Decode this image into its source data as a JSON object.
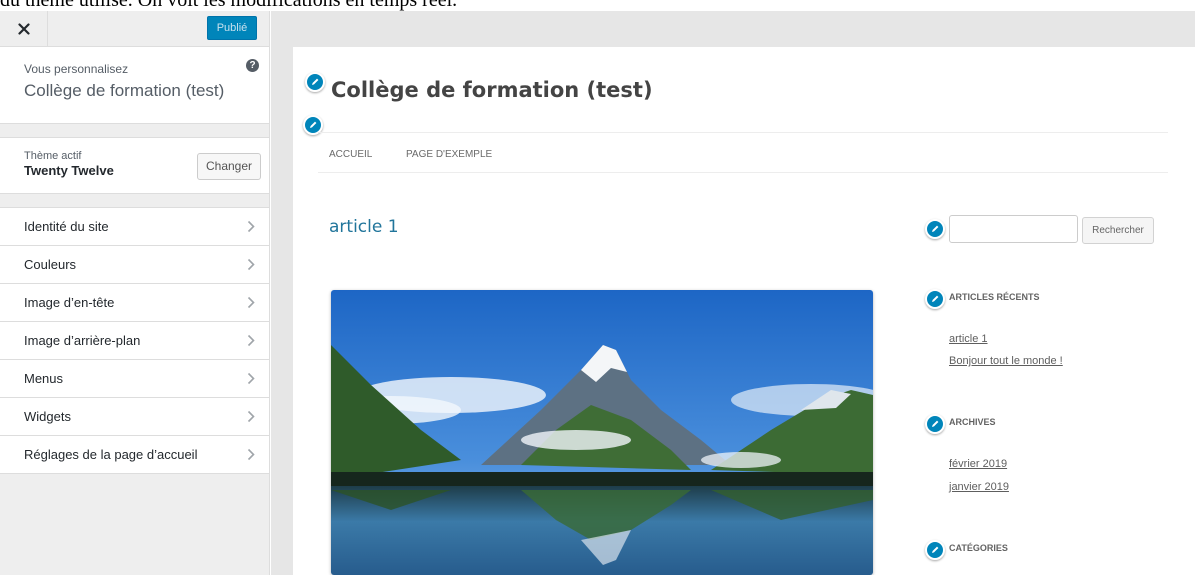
{
  "caption": "du thème utilisé. On voit les modifications en temps réel.",
  "sidebar": {
    "publish_label": "Publié",
    "customizing_label": "Vous personnalisez",
    "site_name": "Collège de formation (test)",
    "help_glyph": "?",
    "theme_label": "Thème actif",
    "theme_name": "Twenty Twelve",
    "change_label": "Changer",
    "items": [
      {
        "label": "Identité du site"
      },
      {
        "label": "Couleurs"
      },
      {
        "label": "Image d’en-tête"
      },
      {
        "label": "Image d’arrière-plan"
      },
      {
        "label": "Menus"
      },
      {
        "label": "Widgets"
      },
      {
        "label": "Réglages de la page d’accueil"
      }
    ]
  },
  "preview": {
    "site_title": "Collège de formation (test)",
    "nav": [
      "ACCUEIL",
      "PAGE D'EXEMPLE"
    ],
    "post_title": "article 1",
    "search_button": "Rechercher",
    "widgets": {
      "recent_title": "ARTICLES RÉCENTS",
      "recent_links": [
        "article 1",
        "Bonjour tout le monde !"
      ],
      "archives_title": "ARCHIVES",
      "archive_links": [
        "février 2019",
        "janvier 2019"
      ],
      "categories_title": "CATÉGORIES"
    }
  },
  "colors": {
    "accent": "#0085ba",
    "link": "#21759b"
  },
  "icons": [
    "close-icon",
    "help-icon",
    "chevron-right-icon",
    "pencil-icon"
  ]
}
